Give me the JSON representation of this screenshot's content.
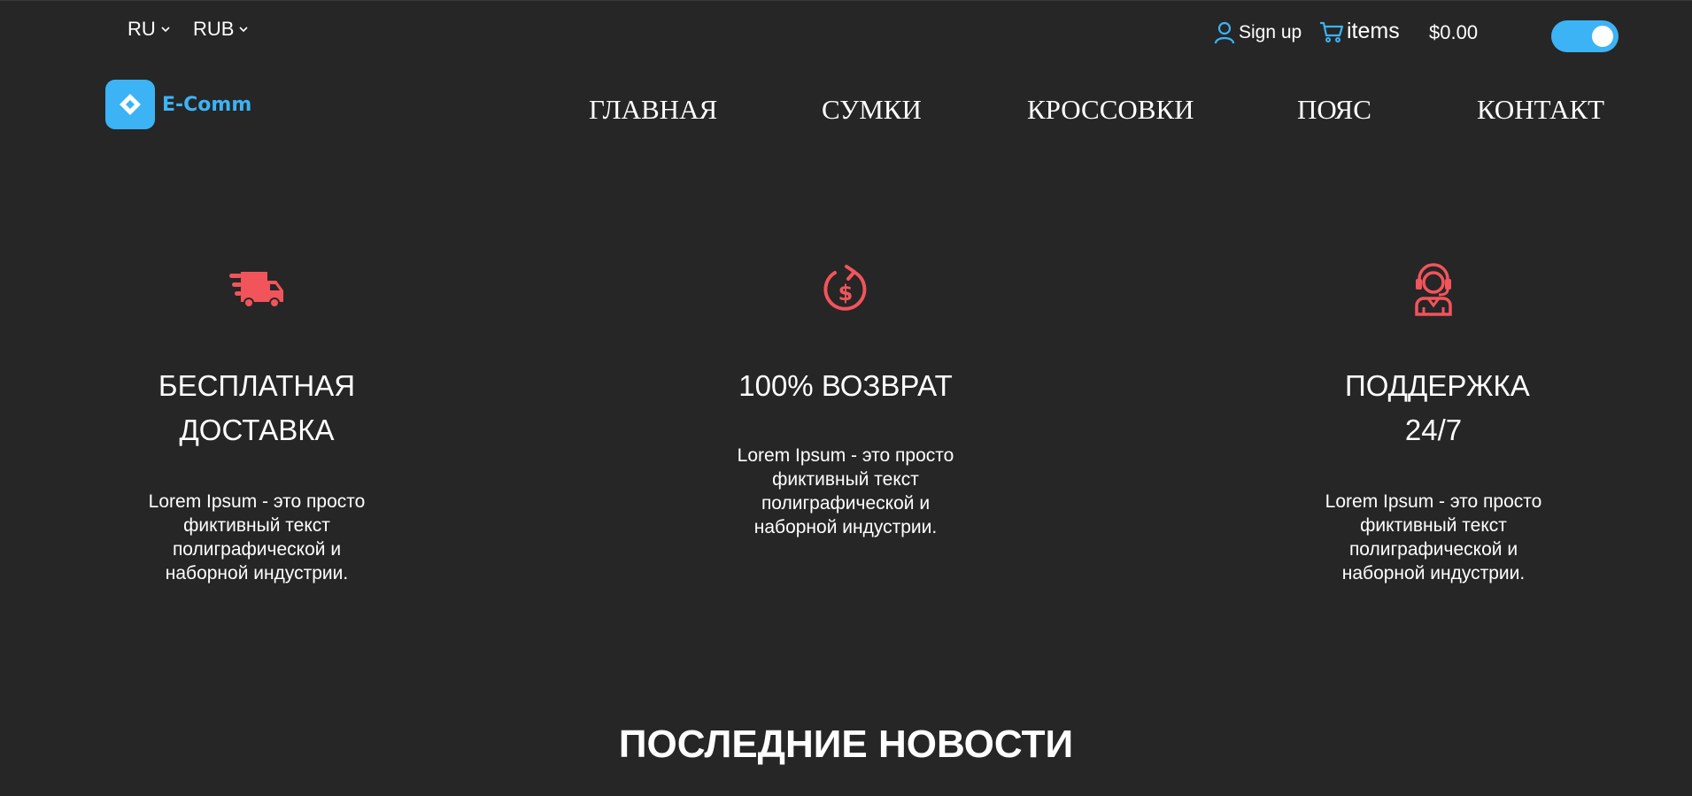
{
  "topbar": {
    "language": "RU",
    "currency": "RUB",
    "signup_label": "Sign up",
    "cart_label": "items",
    "cart_total": "$0.00",
    "theme_toggle_on": true
  },
  "nav": {
    "logo_text": "E-Comm",
    "items": [
      {
        "label": "ГЛАВНАЯ"
      },
      {
        "label": "СУМКИ"
      },
      {
        "label": "КРОССОВКИ"
      },
      {
        "label": "ПОЯС"
      },
      {
        "label": "КОНТАКТ"
      }
    ]
  },
  "features": [
    {
      "icon": "delivery-truck-icon",
      "title": "БЕСПЛАТНАЯ ДОСТАВКА",
      "text": "Lorem Ipsum - это просто фиктивный текст полиграфической и наборной индустрии."
    },
    {
      "icon": "money-return-icon",
      "title": "100% ВОЗВРАТ",
      "text": "Lorem Ipsum - это просто фиктивный текст полиграфической и наборной индустрии."
    },
    {
      "icon": "support-agent-icon",
      "title": "ПОДДЕРЖКА 24/7",
      "text": "Lorem Ipsum - это просто фиктивный текст полиграфической и наборной индустрии."
    }
  ],
  "news": {
    "title": "ПОСЛЕДНИЕ НОВОСТИ"
  },
  "colors": {
    "background": "#262626",
    "accent": "#3cb3f5",
    "icon_red": "#f2545b",
    "text": "#ffffff"
  }
}
